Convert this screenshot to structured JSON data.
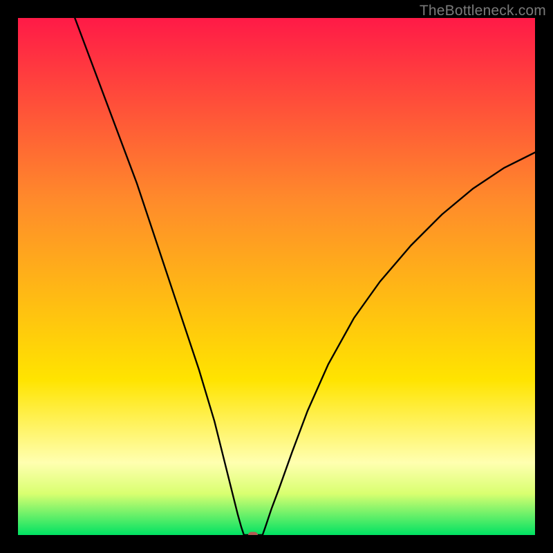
{
  "watermark": {
    "text": "TheBottleneck.com"
  },
  "colors": {
    "black": "#000000",
    "curve": "#000000",
    "marker": "#b35a54",
    "watermark": "#7a7a7a",
    "gradient_top": "#ff1a47",
    "gradient_mid1": "#ff8a2b",
    "gradient_mid2": "#ffe400",
    "gradient_pale": "#ffffb0",
    "gradient_green": "#00e263"
  },
  "chart_data": {
    "type": "line",
    "title": "",
    "xlabel": "",
    "ylabel": "",
    "xlim": [
      0,
      100
    ],
    "ylim": [
      0,
      100
    ],
    "legend": false,
    "grid": false,
    "background_gradient_stops_pct": [
      {
        "at": 0,
        "color": "#ff1a47"
      },
      {
        "at": 35,
        "color": "#ff8a2b"
      },
      {
        "at": 70,
        "color": "#ffe400"
      },
      {
        "at": 86,
        "color": "#ffffb0"
      },
      {
        "at": 92,
        "color": "#d9ff70"
      },
      {
        "at": 100,
        "color": "#00e263"
      }
    ],
    "series": [
      {
        "name": "left-branch",
        "x": [
          11,
          14,
          17,
          20,
          23,
          26,
          29,
          32,
          35,
          38,
          40,
          41.5,
          42.5,
          43.2,
          43.7
        ],
        "y": [
          100,
          92,
          84,
          76,
          68,
          59,
          50,
          41,
          32,
          22,
          14,
          8,
          4,
          1.5,
          0
        ]
      },
      {
        "name": "right-branch",
        "x": [
          47.3,
          48,
          49,
          50.5,
          53,
          56,
          60,
          65,
          70,
          76,
          82,
          88,
          94,
          100
        ],
        "y": [
          0,
          2,
          5,
          9,
          16,
          24,
          33,
          42,
          49,
          56,
          62,
          67,
          71,
          74
        ]
      },
      {
        "name": "floor-segment",
        "x": [
          43.7,
          47.3
        ],
        "y": [
          0,
          0
        ]
      }
    ],
    "marker": {
      "x": 45.5,
      "y": 0,
      "name": "current-point"
    }
  }
}
